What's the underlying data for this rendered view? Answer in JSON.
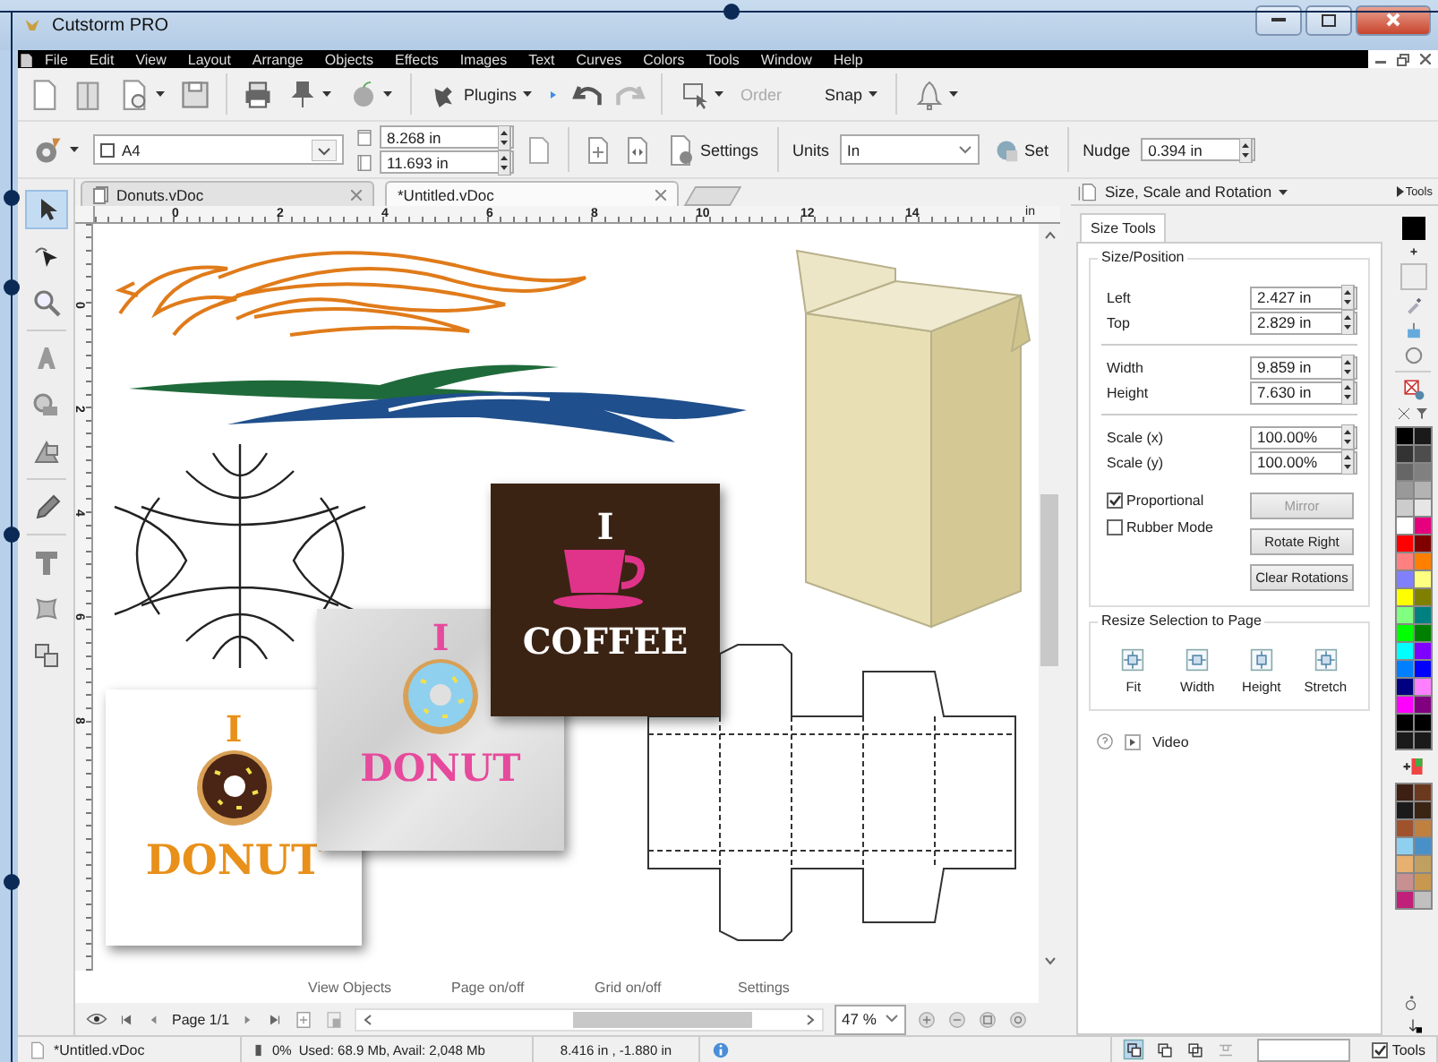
{
  "window": {
    "title": "Cutstorm PRO"
  },
  "menu": [
    "File",
    "Edit",
    "View",
    "Layout",
    "Arrange",
    "Objects",
    "Effects",
    "Images",
    "Text",
    "Curves",
    "Colors",
    "Tools",
    "Window",
    "Help"
  ],
  "toolbar": {
    "plugins": "Plugins",
    "order": {
      "label": "Order",
      "disabled": true
    },
    "snap": "Snap"
  },
  "page_bar": {
    "paper": "A4",
    "width": "8.268 in",
    "height": "11.693 in",
    "settings": "Settings",
    "units_label": "Units",
    "units": "In",
    "set": "Set",
    "nudge_label": "Nudge",
    "nudge": "0.394 in"
  },
  "tools": [
    {
      "kind": "pointer",
      "selected": true
    },
    {
      "kind": "node",
      "selected": false
    },
    {
      "kind": "zoom",
      "selected": false
    },
    {
      "kind": "text-art",
      "selected": false
    },
    {
      "kind": "shape",
      "selected": false
    },
    {
      "kind": "shape-edit",
      "selected": false
    },
    {
      "kind": "pen",
      "selected": false
    },
    {
      "kind": "text",
      "selected": false
    },
    {
      "kind": "envelope",
      "selected": false
    },
    {
      "kind": "weld",
      "selected": false
    }
  ],
  "doc_tabs": [
    {
      "label": "Donuts.vDoc",
      "selected": false
    },
    {
      "label": "*Untitled.vDoc",
      "selected": true
    }
  ],
  "ruler": {
    "ticks": [
      "0",
      "2",
      "4",
      "6",
      "8",
      "10",
      "12",
      "14"
    ],
    "unit": "in",
    "vticks": [
      "0",
      "2",
      "4",
      "6",
      "8"
    ]
  },
  "artwork": [
    {
      "kind": "flame-bird"
    },
    {
      "kind": "tribal"
    },
    {
      "kind": "ornament"
    },
    {
      "kind": "box-3d"
    },
    {
      "kind": "dieline"
    },
    {
      "kind": "donut-card",
      "crumpled": false,
      "lines": [
        "I",
        "DONUT"
      ]
    },
    {
      "kind": "donut-card",
      "crumpled": true,
      "lines": [
        "I",
        "DONUT"
      ]
    },
    {
      "kind": "coffee-card",
      "lines": [
        "I",
        "COFFEE"
      ]
    }
  ],
  "canvas_bar": [
    "View Objects",
    "Page on/off",
    "Grid on/off",
    "Settings"
  ],
  "pager": {
    "page": "Page 1/1",
    "zoom": "47 %"
  },
  "panel": {
    "title": "Size, Scale and Rotation",
    "tools_link": "Tools",
    "tab": "Size Tools",
    "group": "Size/Position",
    "fields": [
      {
        "label": "Left",
        "value": "2.427 in"
      },
      {
        "label": "Top",
        "value": "2.829 in"
      },
      {
        "label": "Width",
        "value": "9.859 in"
      },
      {
        "label": "Height",
        "value": "7.630 in"
      },
      {
        "label": "Scale (x)",
        "value": "100.00%"
      },
      {
        "label": "Scale (y)",
        "value": "100.00%"
      }
    ],
    "checks": [
      {
        "label": "Proportional",
        "checked": true
      },
      {
        "label": "Rubber Mode",
        "checked": false
      }
    ],
    "buttons": [
      {
        "label": "Mirror",
        "disabled": true
      },
      {
        "label": "Rotate Right",
        "disabled": false
      },
      {
        "label": "Clear Rotations",
        "disabled": false
      }
    ],
    "resize_group": "Resize Selection to Page",
    "resize": [
      "Fit",
      "Width",
      "Height",
      "Stretch"
    ],
    "video": "Video"
  },
  "palette": [
    {
      "color": "#000000"
    },
    {
      "color": "#1a1a1a"
    },
    {
      "color": "#333333"
    },
    {
      "color": "#4d4d4d"
    },
    {
      "color": "#666666"
    },
    {
      "color": "#808080"
    },
    {
      "color": "#999999"
    },
    {
      "color": "#b3b3b3"
    },
    {
      "color": "#cccccc"
    },
    {
      "color": "#e6e6e6"
    },
    {
      "color": "#ffffff"
    },
    {
      "color": "#e6007e"
    },
    {
      "color": "#ff0000"
    },
    {
      "color": "#800000"
    },
    {
      "color": "#ff8080"
    },
    {
      "color": "#ff8000"
    },
    {
      "color": "#8080ff"
    },
    {
      "color": "#ffff80"
    },
    {
      "color": "#ffff00"
    },
    {
      "color": "#808000"
    },
    {
      "color": "#80ff80"
    },
    {
      "color": "#008080"
    },
    {
      "color": "#00ff00"
    },
    {
      "color": "#008000"
    },
    {
      "color": "#00ffff"
    },
    {
      "color": "#8000ff"
    },
    {
      "color": "#0080ff"
    },
    {
      "color": "#0000ff"
    },
    {
      "color": "#000080"
    },
    {
      "color": "#ff80ff"
    },
    {
      "color": "#ff00ff"
    },
    {
      "color": "#800080"
    },
    {
      "color": "#000000"
    },
    {
      "color": "#000000"
    },
    {
      "color": "#1a1a1a"
    },
    {
      "color": "#1a1a1a"
    }
  ],
  "palette2": [
    {
      "color": "#3d1f14"
    },
    {
      "color": "#6b3a1e"
    },
    {
      "color": "#1a1a1a"
    },
    {
      "color": "#3a2414"
    },
    {
      "color": "#a0522d"
    },
    {
      "color": "#c08040"
    },
    {
      "color": "#8fd0f0"
    },
    {
      "color": "#4a90c8"
    },
    {
      "color": "#e8b070"
    },
    {
      "color": "#c0a060"
    },
    {
      "color": "#c89090"
    },
    {
      "color": "#c89850"
    },
    {
      "color": "#c0207a"
    },
    {
      "color": "#c0c0c0"
    }
  ],
  "status": {
    "file": "*Untitled.vDoc",
    "percent": "0%",
    "memory": "Used: 68.9 Mb, Avail: 2,048 Mb",
    "coords": "8.416 in , -1.880 in",
    "tools": {
      "label": "Tools",
      "checked": true
    }
  }
}
